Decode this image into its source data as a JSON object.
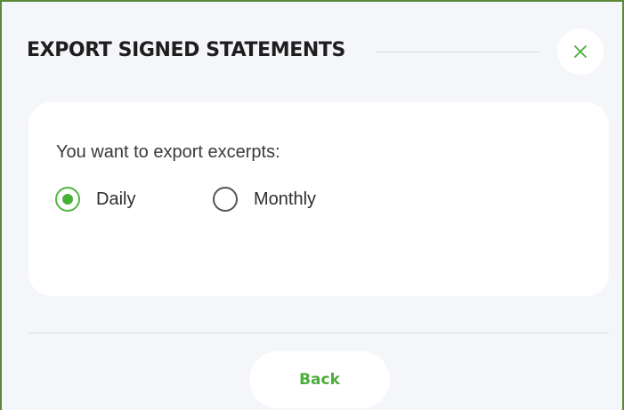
{
  "dialog": {
    "title": "EXPORT SIGNED STATEMENTS",
    "close_icon": "close-x-icon",
    "accent_color": "#4cae3a",
    "border_color": "#5a8a3a"
  },
  "form": {
    "question": "You want to export excerpts:",
    "options": [
      {
        "label": "Daily",
        "selected": true
      },
      {
        "label": "Monthly",
        "selected": false
      }
    ]
  },
  "footer": {
    "back_label": "Back"
  }
}
